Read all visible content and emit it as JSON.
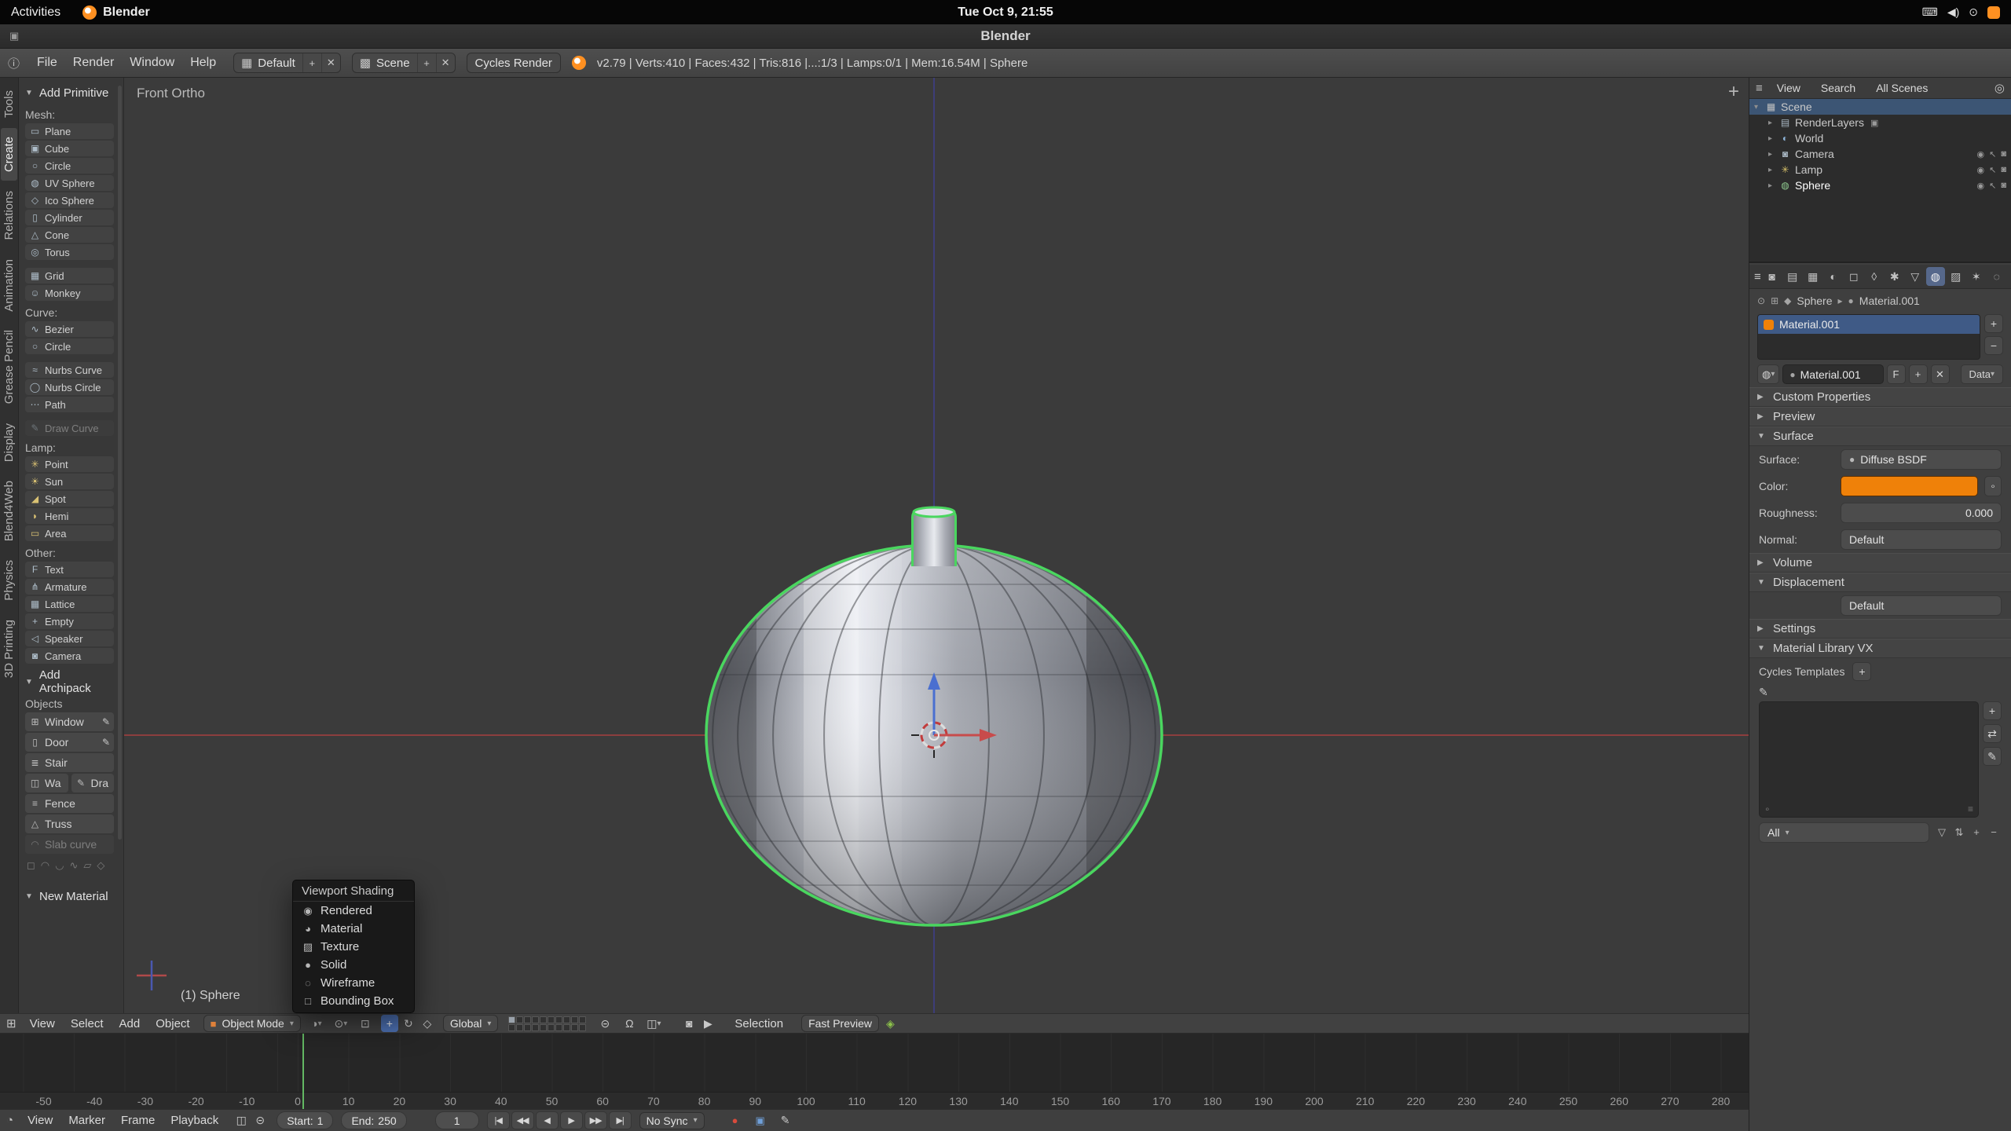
{
  "colors": {
    "selection_green": "#4ad65f",
    "axis_x_red": "#8c3e3e",
    "axis_z_blue": "#3d3d78",
    "manip_blue": "#4a6fd0",
    "manip_red": "#c84b4b",
    "cursor_red": "#c23c3c",
    "material_orange": "#ef8109",
    "frame_line_green": "#63b863",
    "gnome_accent_orange": "#ff9021"
  },
  "ui": {
    "chevron": "▾",
    "tri_open": "▼",
    "tri_closed": "▶",
    "plus": "+",
    "close": "✕",
    "minus": "−",
    "grip_dot": "∘",
    "grip_lines": "≡"
  },
  "gnome_bar": {
    "activities_label": "Activities",
    "app_button_label": "Blender",
    "clock": "Tue Oct 9, 21:55",
    "tray": [
      {
        "icon": "keyboard-indicator-icon",
        "glyph": "⌨"
      },
      {
        "icon": "volume-icon",
        "glyph": "◀)"
      },
      {
        "icon": "power-icon",
        "glyph": "⊙"
      },
      {
        "icon": "notification-indicator-icon",
        "glyph": "",
        "cls": "orange-box"
      }
    ]
  },
  "titlebar": {
    "title": "Blender",
    "window_icon_glyph": "▣"
  },
  "infobar": {
    "editor_icon_glyph": "ⓘ",
    "menus": [
      {
        "label": "File"
      },
      {
        "label": "Render"
      },
      {
        "label": "Window"
      },
      {
        "label": "Help"
      }
    ],
    "layout": {
      "icon_glyph": "▦",
      "value": "Default"
    },
    "scene": {
      "icon_glyph": "▩",
      "value": "Scene"
    },
    "engine_value": "Cycles Render",
    "stats": "v2.79 | Verts:410 | Faces:432 | Tris:816 |...:1/3 | Lamps:0/1 | Mem:16.54M | Sphere"
  },
  "toolshelf": {
    "tabs": [
      {
        "label": "Tools"
      },
      {
        "label": "Create",
        "active": true
      },
      {
        "label": "Relations"
      },
      {
        "label": "Animation"
      },
      {
        "label": "Grease Pencil"
      },
      {
        "label": "Display"
      },
      {
        "label": "Blend4Web"
      },
      {
        "label": "Physics"
      },
      {
        "label": "3D Printing"
      }
    ],
    "add_primitive_header": "Add Primitive",
    "mesh_label": "Mesh:",
    "mesh_items": [
      {
        "label": "Plane",
        "icon": "plane-icon",
        "glyph": "▭"
      },
      {
        "label": "Cube",
        "icon": "cube-icon",
        "glyph": "▣"
      },
      {
        "label": "Circle",
        "icon": "circle-icon",
        "glyph": "○"
      },
      {
        "label": "UV Sphere",
        "icon": "uv-sphere-icon",
        "glyph": "◍"
      },
      {
        "label": "Ico Sphere",
        "icon": "ico-sphere-icon",
        "glyph": "◇"
      },
      {
        "label": "Cylinder",
        "icon": "cylinder-icon",
        "glyph": "▯"
      },
      {
        "label": "Cone",
        "icon": "cone-icon",
        "glyph": "△"
      },
      {
        "label": "Torus",
        "icon": "torus-icon",
        "glyph": "◎"
      },
      {
        "label": "Grid",
        "icon": "grid-icon",
        "glyph": "▦",
        "cls": "gap-top"
      },
      {
        "label": "Monkey",
        "icon": "monkey-icon",
        "glyph": "☺"
      }
    ],
    "curve_label": "Curve:",
    "curve_items": [
      {
        "label": "Bezier",
        "icon": "bezier-curve-icon",
        "glyph": "∿"
      },
      {
        "label": "Circle",
        "icon": "curve-circle-icon",
        "glyph": "○"
      },
      {
        "label": "Nurbs Curve",
        "icon": "nurbs-curve-icon",
        "glyph": "≈",
        "cls": "gap-top"
      },
      {
        "label": "Nurbs Circle",
        "icon": "nurbs-circle-icon",
        "glyph": "◯"
      },
      {
        "label": "Path",
        "icon": "path-icon",
        "glyph": "⋯"
      },
      {
        "label": "Draw Curve",
        "icon": "draw-curve-icon",
        "glyph": "✎",
        "cls": "gap-top disabled"
      }
    ],
    "lamp_label": "Lamp:",
    "lamp_items": [
      {
        "label": "Point",
        "icon": "point-lamp-icon",
        "glyph": "✳"
      },
      {
        "label": "Sun",
        "icon": "sun-lamp-icon",
        "glyph": "☀"
      },
      {
        "label": "Spot",
        "icon": "spot-lamp-icon",
        "glyph": "◢"
      },
      {
        "label": "Hemi",
        "icon": "hemi-lamp-icon",
        "glyph": "◗"
      },
      {
        "label": "Area",
        "icon": "area-lamp-icon",
        "glyph": "▭"
      }
    ],
    "other_label": "Other:",
    "other_items": [
      {
        "label": "Text",
        "icon": "text-icon",
        "glyph": "F"
      },
      {
        "label": "Armature",
        "icon": "armature-icon",
        "glyph": "⋔"
      },
      {
        "label": "Lattice",
        "icon": "lattice-icon",
        "glyph": "▦"
      },
      {
        "label": "Empty",
        "icon": "empty-icon",
        "glyph": "+"
      },
      {
        "label": "Speaker",
        "icon": "speaker-icon",
        "glyph": "◁"
      },
      {
        "label": "Camera",
        "icon": "add-camera-icon",
        "glyph": "◙"
      }
    ],
    "archipack_header": "Add Archipack",
    "objects_label": "Objects",
    "archipack_items": [
      {
        "label": "Window",
        "icon": "window-icon",
        "glyph": "⊞",
        "edit_glyph": "✎",
        "cls": "big"
      },
      {
        "label": "Door",
        "icon": "door-icon",
        "glyph": "▯",
        "edit_glyph": "✎",
        "cls": "big"
      },
      {
        "label": "Stair",
        "icon": "stair-icon",
        "glyph": "≣",
        "cls": "big"
      },
      {
        "label": "Wa",
        "icon": "wall-icon",
        "glyph": "◫",
        "cls": "big half"
      },
      {
        "label": "Dra",
        "icon": "draw-wall-icon",
        "glyph": "✎",
        "cls": "big half"
      },
      {
        "label": "Fence",
        "icon": "fence-icon",
        "glyph": "≡",
        "cls": "big"
      },
      {
        "label": "Truss",
        "icon": "truss-icon",
        "glyph": "△",
        "cls": "big"
      },
      {
        "label": "Slab curve",
        "icon": "slab-curve-icon",
        "glyph": "◠",
        "cls": "big disabled"
      }
    ],
    "footer_icons": [
      {
        "icon": "kilt-icon",
        "glyph": "◻"
      },
      {
        "icon": "arc-up-icon",
        "glyph": "◠"
      },
      {
        "icon": "arc-down-icon",
        "glyph": "◡"
      },
      {
        "icon": "curve-tool-icon",
        "glyph": "∿"
      },
      {
        "icon": "poly-tool-icon",
        "glyph": "▱"
      },
      {
        "icon": "misc-tool-icon",
        "glyph": "◇"
      }
    ],
    "new_material_header": "New Material"
  },
  "viewport": {
    "view_label": "Front Ortho",
    "object_info": "(1) Sphere",
    "add_region_glyph": "+"
  },
  "shading_popup": {
    "title": "Viewport Shading",
    "items": [
      {
        "label": "Rendered",
        "icon": "rendered-shading-icon",
        "glyph": "◉"
      },
      {
        "label": "Material",
        "icon": "material-shading-icon",
        "glyph": "◕"
      },
      {
        "label": "Texture",
        "icon": "texture-shading-icon",
        "glyph": "▨"
      },
      {
        "label": "Solid",
        "icon": "solid-shading-icon",
        "glyph": "●"
      },
      {
        "label": "Wireframe",
        "icon": "wireframe-shading-icon",
        "glyph": "◌"
      },
      {
        "label": "Bounding Box",
        "icon": "bounding-box-shading-icon",
        "glyph": "□"
      }
    ]
  },
  "vp_header": {
    "editor_icon_glyph": "⊞",
    "menus": [
      {
        "label": "View"
      },
      {
        "label": "Select"
      },
      {
        "label": "Add"
      },
      {
        "label": "Object"
      }
    ],
    "mode": {
      "icon_glyph": "■",
      "label": "Object Mode"
    },
    "shading_icon_glyph": "◑",
    "pivot_icon_glyph": "⊙",
    "align_icon_glyph": "⊡",
    "manip_icons": [
      {
        "icon": "translate-manipulator-icon",
        "glyph": "+",
        "active": true
      },
      {
        "icon": "rotate-manipulator-icon",
        "glyph": "↻"
      },
      {
        "icon": "scale-manipulator-icon",
        "glyph": "◇"
      }
    ],
    "orientation_value": "Global",
    "layers": [
      1,
      0,
      0,
      0,
      0,
      0,
      0,
      0,
      0,
      0,
      0,
      0,
      0,
      0,
      0,
      0,
      0,
      0,
      0,
      0
    ],
    "lock_icon_glyph": "⊝",
    "snap_icon_glyph": "Ω",
    "snap_target_icon_glyph": "◫",
    "render_icons": [
      {
        "icon": "opengl-render-image-icon",
        "glyph": "◙"
      },
      {
        "icon": "opengl-render-anim-icon",
        "glyph": "▶"
      }
    ],
    "selection_label": "Selection",
    "fast_preview_label": "Fast Preview",
    "b4w_icon_glyph": "◈"
  },
  "timeline": {
    "editor_icon_glyph": "◔",
    "menus": [
      {
        "label": "View"
      },
      {
        "label": "Marker"
      },
      {
        "label": "Frame"
      },
      {
        "label": "Playback"
      }
    ],
    "toggle_icons": [
      {
        "icon": "preview-range-icon",
        "glyph": "◫"
      },
      {
        "icon": "frame-lock-icon",
        "glyph": "⊝"
      }
    ],
    "start": {
      "label": "Start:",
      "value": "1"
    },
    "end": {
      "label": "End:",
      "value": "250"
    },
    "current_frame": "1",
    "playback": [
      {
        "icon": "jump-to-start-icon",
        "glyph": "|◀"
      },
      {
        "icon": "prev-keyframe-icon",
        "glyph": "◀◀"
      },
      {
        "icon": "play-reverse-icon",
        "glyph": "◀"
      },
      {
        "icon": "play-icon",
        "glyph": "▶"
      },
      {
        "icon": "next-keyframe-icon",
        "glyph": "▶▶"
      },
      {
        "icon": "jump-to-end-icon",
        "glyph": "▶|"
      }
    ],
    "sync_value": "No Sync",
    "record_icon_glyph": "●",
    "keying_icon_glyph": "▣",
    "pencil_icon_glyph": "✎",
    "ticks": [
      -50,
      -40,
      -30,
      -20,
      -10,
      0,
      10,
      20,
      30,
      40,
      50,
      60,
      70,
      80,
      90,
      100,
      110,
      120,
      130,
      140,
      150,
      160,
      170,
      180,
      190,
      200,
      210,
      220,
      230,
      240,
      250,
      260,
      270,
      280
    ]
  },
  "outliner": {
    "header": {
      "editor_icon_glyph": "≡",
      "view_label": "View",
      "search_label": "Search",
      "scenes_value": "All Scenes",
      "search_icon_glyph": "◎"
    },
    "rows": [
      {
        "label": "Scene",
        "icon": "scene-icon",
        "glyph": "▦",
        "exp": "▾",
        "cls": "selected",
        "icon_style": "color:#c0c0c0"
      },
      {
        "label": "RenderLayers",
        "icon": "renderlayers-icon",
        "glyph": "▤",
        "exp": "▸",
        "cls": "ind1",
        "after_glyph": "▣",
        "after_icon": "render-result-icon"
      },
      {
        "label": "World",
        "icon": "world-icon",
        "glyph": "◐",
        "exp": "▸",
        "cls": "ind1",
        "icon_style": "color:#8db4d8"
      },
      {
        "label": "Camera",
        "icon": "camera-icon",
        "glyph": "◙",
        "exp": "▸",
        "cls": "ind1",
        "t1": "◉",
        "t2": "↖",
        "t3": "◙"
      },
      {
        "label": "Lamp",
        "icon": "lamp-icon",
        "glyph": "✳",
        "exp": "▸",
        "cls": "ind1",
        "icon_style": "color:#d8c26a",
        "t1": "◉",
        "t2": "↖",
        "t3": "◙"
      },
      {
        "label": "Sphere",
        "icon": "mesh-data-icon",
        "glyph": "◍",
        "exp": "▸",
        "cls": "ind1 active",
        "icon_style": "color:#8fc98f",
        "t1": "◉",
        "t2": "↖",
        "t3": "◙"
      }
    ]
  },
  "properties": {
    "editor_icon_glyph": "≡",
    "tabs": [
      {
        "icon": "render-tab-icon",
        "glyph": "◙"
      },
      {
        "icon": "render-layers-tab-icon",
        "glyph": "▤"
      },
      {
        "icon": "scene-tab-icon",
        "glyph": "▦"
      },
      {
        "icon": "world-tab-icon",
        "glyph": "◐"
      },
      {
        "icon": "object-tab-icon",
        "glyph": "◻"
      },
      {
        "icon": "constraints-tab-icon",
        "glyph": "◊"
      },
      {
        "icon": "modifiers-tab-icon",
        "glyph": "✱"
      },
      {
        "icon": "object-data-tab-icon",
        "glyph": "▽"
      },
      {
        "icon": "material-tab-icon",
        "glyph": "◍",
        "active": true
      },
      {
        "icon": "texture-tab-icon",
        "glyph": "▨"
      },
      {
        "icon": "particles-tab-icon",
        "glyph": "✶"
      },
      {
        "icon": "physics-tab-icon",
        "glyph": "◌"
      }
    ],
    "breadcrumb": {
      "pin_icon_glyph": "⊙",
      "nodes_icon_glyph": "⊞",
      "object_icon_glyph": "◆",
      "object_label": "Sphere",
      "sep_glyph": "▸",
      "material_icon_glyph": "●",
      "material_label": "Material.001"
    },
    "slots": {
      "name": "Material.001"
    },
    "datablock": {
      "browse_icon_glyph": "◍",
      "name_icon_glyph": "●",
      "name": "Material.001",
      "fake_user_label": "F",
      "link_label": "Data"
    },
    "panels": {
      "custom_properties": "Custom Properties",
      "preview": "Preview",
      "surface": "Surface",
      "volume": "Volume",
      "displacement": "Displacement",
      "settings": "Settings",
      "matlib": "Material Library VX"
    },
    "surface": {
      "surface_label": "Surface:",
      "surface_icon_glyph": "●",
      "surface_value": "Diffuse BSDF",
      "color_label": "Color:",
      "color_hex": "#ef8109",
      "node_dot_glyph": "∘",
      "roughness_label": "Roughness:",
      "roughness_value": "0.000",
      "normal_label": "Normal:",
      "normal_value": "Default"
    },
    "displacement_value": "Default",
    "matlib": {
      "templates_label": "Cycles Templates",
      "eyedropper_glyph": "✎",
      "side_buttons": [
        {
          "icon": "add-material-icon",
          "glyph": "+"
        },
        {
          "icon": "swap-material-icon",
          "glyph": "⇄"
        },
        {
          "icon": "edit-material-icon",
          "glyph": "✎"
        }
      ],
      "filter_value": "All",
      "filter_icons": [
        {
          "icon": "filter-icon",
          "glyph": "▽"
        },
        {
          "icon": "sort-icon",
          "glyph": "⇅"
        },
        {
          "icon": "add-filter-icon",
          "glyph": "+"
        },
        {
          "icon": "remove-filter-icon",
          "glyph": "−"
        }
      ]
    }
  }
}
